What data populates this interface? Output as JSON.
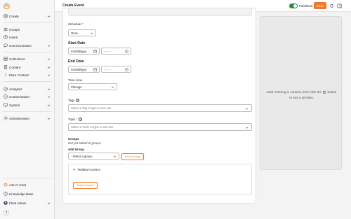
{
  "app": {
    "page_title": "Create Event"
  },
  "topbar": {
    "published_label": "Published",
    "published_on": true,
    "save_label": "Save"
  },
  "sidebar": {
    "items": [
      {
        "label": "Create",
        "icon": "plus-circle-icon",
        "has_chevron": true
      },
      {
        "label": "Groups",
        "icon": "groups-icon",
        "has_chevron": false
      },
      {
        "label": "Users",
        "icon": "user-icon",
        "has_chevron": false
      },
      {
        "label": "Communication",
        "icon": "chat-icon",
        "has_chevron": true
      },
      {
        "label": "Collections",
        "icon": "collections-icon",
        "has_chevron": true
      },
      {
        "label": "Content",
        "icon": "content-icon",
        "has_chevron": true
      },
      {
        "label": "More Content",
        "icon": "more-icon",
        "has_chevron": true
      },
      {
        "label": "Analytics",
        "icon": "analytics-icon",
        "has_chevron": true
      },
      {
        "label": "Customization",
        "icon": "customization-icon",
        "has_chevron": true
      },
      {
        "label": "System",
        "icon": "system-icon",
        "has_chevron": true
      },
      {
        "label": "Administration",
        "icon": "administration-icon",
        "has_chevron": true
      }
    ],
    "bottom_items": [
      {
        "label": "Ask AI Chat",
        "icon": "ai-chat-icon"
      },
      {
        "label": "Knowledge Base",
        "icon": "knowledge-base-icon"
      },
      {
        "label": "Float Admin",
        "icon": "avatar-icon",
        "has_chevron": true
      }
    ]
  },
  "form": {
    "schedule_label": "Schedule",
    "schedule_value": "Once",
    "start_date_label": "Start Date",
    "start_date_placeholder": "mm/dd/yyyy",
    "start_time_placeholder": "--:-- --",
    "end_date_label": "End Date",
    "end_date_placeholder": "mm/dd/yyyy",
    "end_time_placeholder": "--:-- --",
    "timezone_label": "Time zone",
    "timezone_value": "Chicago",
    "tags_label": "Tags",
    "tags_placeholder": "Select a Tag or type a new one",
    "topic_label": "Topic",
    "topic_placeholder": "Select a Topic or type a new one",
    "groups_label": "Groups",
    "groups_empty": "Not yet added to groups",
    "add_group_label": "Add Group",
    "group_select_value": "- Select a group -",
    "add_to_group_button": "Add to Group",
    "related_content_label": "Related Content",
    "select_content_button": "Select Content"
  },
  "preview": {
    "message_before": "Start entering in content, then click the",
    "message_after": "button to see a preview."
  },
  "colors": {
    "accent": "#f07a2a",
    "toggle_on": "#2e8b3e"
  }
}
